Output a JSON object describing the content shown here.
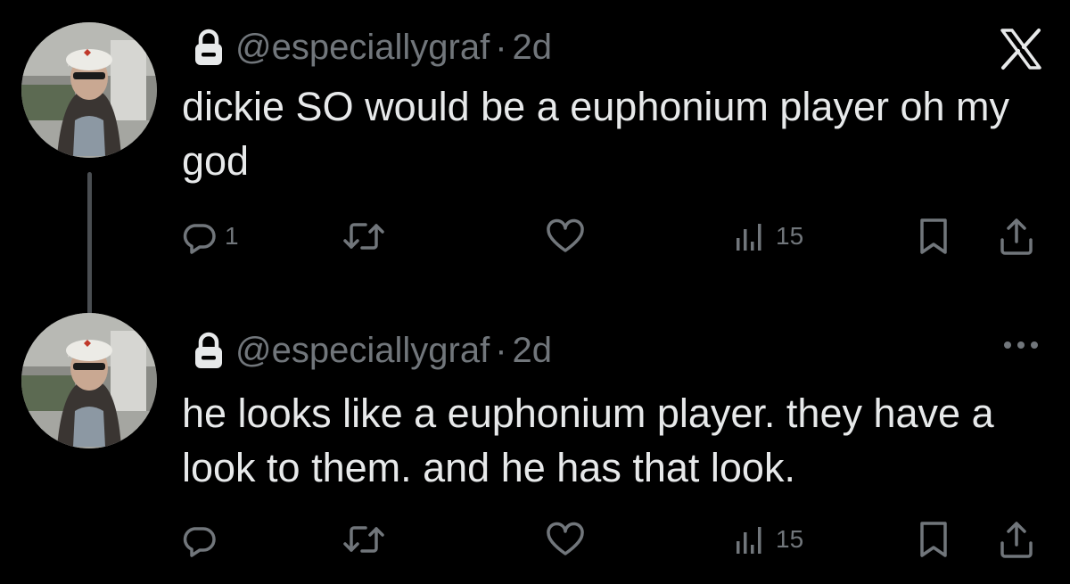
{
  "colors": {
    "background": "#000000",
    "text_primary": "#e7e9ea",
    "text_secondary": "#71767b",
    "thread_line": "#4a4e52"
  },
  "tweets": [
    {
      "avatar_icon": "user-avatar-photo",
      "lock_icon": "lock-icon",
      "handle": "@especiallygraf",
      "separator": "·",
      "time": "2d",
      "text": "dickie SO would be a euphonium player oh my god",
      "top_right_icon": "x-logo-icon",
      "actions": {
        "reply_count": "1",
        "retweet_count": "",
        "like_count": "",
        "views_count": "15"
      }
    },
    {
      "avatar_icon": "user-avatar-photo",
      "lock_icon": "lock-icon",
      "handle": "@especiallygraf",
      "separator": "·",
      "time": "2d",
      "text": "he looks like a euphonium player. they have a look to them. and he has that look.",
      "top_right_icon": "more-options-icon",
      "actions": {
        "reply_count": "",
        "retweet_count": "",
        "like_count": "",
        "views_count": "15"
      }
    }
  ]
}
